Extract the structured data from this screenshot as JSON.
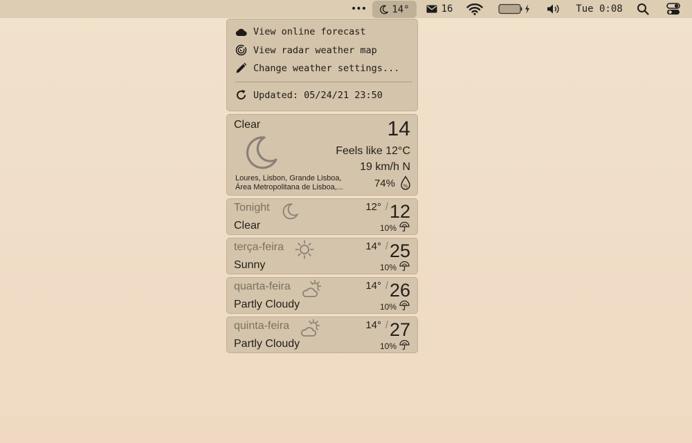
{
  "menubar": {
    "dots": "•••",
    "weather_temp": "14°",
    "mail_count": "16",
    "clock": "Tue 0:08"
  },
  "menu": {
    "items": [
      {
        "label": "View online forecast",
        "icon": "cloud-icon"
      },
      {
        "label": "View radar weather map",
        "icon": "radar-icon"
      },
      {
        "label": "Change weather settings...",
        "icon": "pencil-icon"
      }
    ],
    "updated": "Updated: 05/24/21 23:50"
  },
  "current": {
    "condition": "Clear",
    "temp": "14",
    "feels_like": "Feels like 12°C",
    "wind": "19 km/h N",
    "humidity": "74%",
    "location_line1": "Loures, Lisbon, Grande Lisboa,",
    "location_line2": "Área Metropolitana de Lisboa,..."
  },
  "forecast": [
    {
      "day": "Tonight",
      "condition": "Clear",
      "low": "12°",
      "high": "12",
      "precip": "10%",
      "icon": "moon-icon"
    },
    {
      "day": "terça-feira",
      "condition": "Sunny",
      "low": "14°",
      "high": "25",
      "precip": "10%",
      "icon": "sun-icon"
    },
    {
      "day": "quarta-feira",
      "condition": "Partly Cloudy",
      "low": "14°",
      "high": "26",
      "precip": "10%",
      "icon": "partly-cloudy-icon"
    },
    {
      "day": "quinta-feira",
      "condition": "Partly Cloudy",
      "low": "14°",
      "high": "27",
      "precip": "10%",
      "icon": "partly-cloudy-icon"
    }
  ],
  "colors": {
    "panel": "#d4c4ab",
    "menubar": "#dccdb3",
    "muted_text": "#7b6f60",
    "icon_gray": "#8a8077"
  }
}
